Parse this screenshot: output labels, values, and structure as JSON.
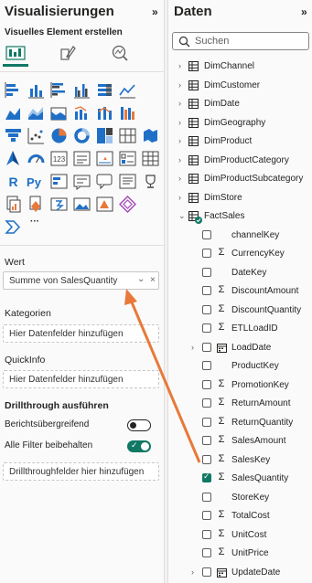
{
  "viz_pane": {
    "title": "Visualisierungen",
    "collapse_glyph": "»",
    "subtitle": "Visuelles Element erstellen",
    "modes": [
      "build-visual-icon",
      "format-visual-icon",
      "analytics-icon"
    ],
    "more_glyph": "···",
    "gallery_icons": [
      "stacked-bar-chart-icon",
      "stacked-column-chart-icon",
      "clustered-bar-chart-icon",
      "clustered-column-chart-icon",
      "100-stacked-bar-chart-icon",
      "line-chart-icon",
      "area-chart-icon",
      "stacked-area-chart-icon",
      "line-and-column-chart-icon",
      "line-and-stacked-column-chart-icon",
      "ribbon-chart-icon",
      "waterfall-chart-icon",
      "funnel-icon",
      "scatter-chart-icon",
      "pie-chart-icon",
      "donut-chart-icon",
      "treemap-icon",
      "map-icon",
      "filled-map-icon",
      "azure-map-icon",
      "gauge-icon",
      "card-icon",
      "multi-row-card-icon",
      "kpi-icon",
      "slicer-icon",
      "table-icon",
      "matrix-icon",
      "r-visual-icon",
      "python-visual-icon",
      "key-influencers-icon",
      "decomposition-tree-icon",
      "qa-icon",
      "narrative-icon",
      "paginated-report-icon",
      "trophy-icon",
      "power-apps-icon",
      "power-automate-icon",
      "image-icon",
      "smart-narrative-icon",
      "diamond-icon",
      "powerbi-chevron-icon"
    ],
    "wells": {
      "value_label": "Wert",
      "value_field": "Summe von SalesQuantity",
      "value_chevron": "⌄",
      "value_remove": "×",
      "categories_label": "Kategorien",
      "categories_placeholder": "Hier Datenfelder hinzufügen",
      "tooltips_label": "QuickInfo",
      "tooltips_placeholder": "Hier Datenfelder hinzufügen"
    },
    "drillthrough": {
      "heading": "Drillthrough ausführen",
      "cross_report_label": "Berichtsübergreifend",
      "cross_report_on": false,
      "keep_filters_label": "Alle Filter beibehalten",
      "keep_filters_on": true,
      "placeholder": "Drillthroughfelder hier hinzufügen"
    }
  },
  "data_pane": {
    "title": "Daten",
    "collapse_glyph": "»",
    "search_placeholder": "Suchen",
    "tables": [
      "DimChannel",
      "DimCustomer",
      "DimDate",
      "DimGeography",
      "DimProduct",
      "DimProductCategory",
      "DimProductSubcategory",
      "DimStore"
    ],
    "expanded_table": "FactSales",
    "fields": [
      {
        "name": "channelKey",
        "type": "none",
        "checked": false
      },
      {
        "name": "CurrencyKey",
        "type": "sum",
        "checked": false
      },
      {
        "name": "DateKey",
        "type": "none",
        "checked": false
      },
      {
        "name": "DiscountAmount",
        "type": "sum",
        "checked": false
      },
      {
        "name": "DiscountQuantity",
        "type": "sum",
        "checked": false
      },
      {
        "name": "ETLLoadID",
        "type": "sum",
        "checked": false
      },
      {
        "name": "LoadDate",
        "type": "date",
        "checked": false
      },
      {
        "name": "ProductKey",
        "type": "none",
        "checked": false
      },
      {
        "name": "PromotionKey",
        "type": "sum",
        "checked": false
      },
      {
        "name": "ReturnAmount",
        "type": "sum",
        "checked": false
      },
      {
        "name": "ReturnQuantity",
        "type": "sum",
        "checked": false
      },
      {
        "name": "SalesAmount",
        "type": "sum",
        "checked": false
      },
      {
        "name": "SalesKey",
        "type": "sum",
        "checked": false
      },
      {
        "name": "SalesQuantity",
        "type": "sum",
        "checked": true
      },
      {
        "name": "StoreKey",
        "type": "none",
        "checked": false
      },
      {
        "name": "TotalCost",
        "type": "sum",
        "checked": false
      },
      {
        "name": "UnitCost",
        "type": "sum",
        "checked": false
      },
      {
        "name": "UnitPrice",
        "type": "sum",
        "checked": false
      },
      {
        "name": "UpdateDate",
        "type": "date",
        "checked": false
      }
    ],
    "sum_glyph": "Σ",
    "expand_glyph": "›",
    "collapse_tree_glyph": "⌄"
  },
  "colors": {
    "accent": "#117865",
    "arrow": "#e8793a",
    "chart_blue": "#1f6fc6",
    "chart_orange": "#e8793a"
  }
}
